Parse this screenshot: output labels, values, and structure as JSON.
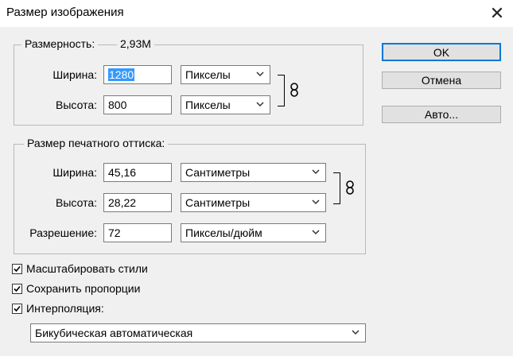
{
  "window": {
    "title": "Размер изображения",
    "close_glyph": "✕"
  },
  "dimensions": {
    "legend": "Размерность:",
    "size_value": "2,93M",
    "width_label": "Ширина:",
    "width_value": "1280",
    "width_unit": "Пикселы",
    "height_label": "Высота:",
    "height_value": "800",
    "height_unit": "Пикселы"
  },
  "print": {
    "legend": "Размер печатного оттиска:",
    "width_label": "Ширина:",
    "width_value": "45,16",
    "width_unit": "Сантиметры",
    "height_label": "Высота:",
    "height_value": "28,22",
    "height_unit": "Сантиметры",
    "resolution_label": "Разрешение:",
    "resolution_value": "72",
    "resolution_unit": "Пикселы/дюйм"
  },
  "buttons": {
    "ok": "OK",
    "cancel": "Отмена",
    "auto": "Авто..."
  },
  "options": {
    "scale_styles": {
      "label": "Масштабировать стили",
      "checked": true
    },
    "constrain": {
      "label": "Сохранить пропорции",
      "checked": true
    },
    "resample": {
      "label": "Интерполяция:",
      "checked": true
    },
    "method": "Бикубическая автоматическая"
  },
  "colors": {
    "background": "#f0f0f0",
    "selection": "#3399ff",
    "default_button_border": "#0078d7"
  },
  "icons": {
    "close": "close-icon",
    "link": "chain-link-icon",
    "dropdown": "chevron-down-icon",
    "check": "checkmark-icon"
  }
}
